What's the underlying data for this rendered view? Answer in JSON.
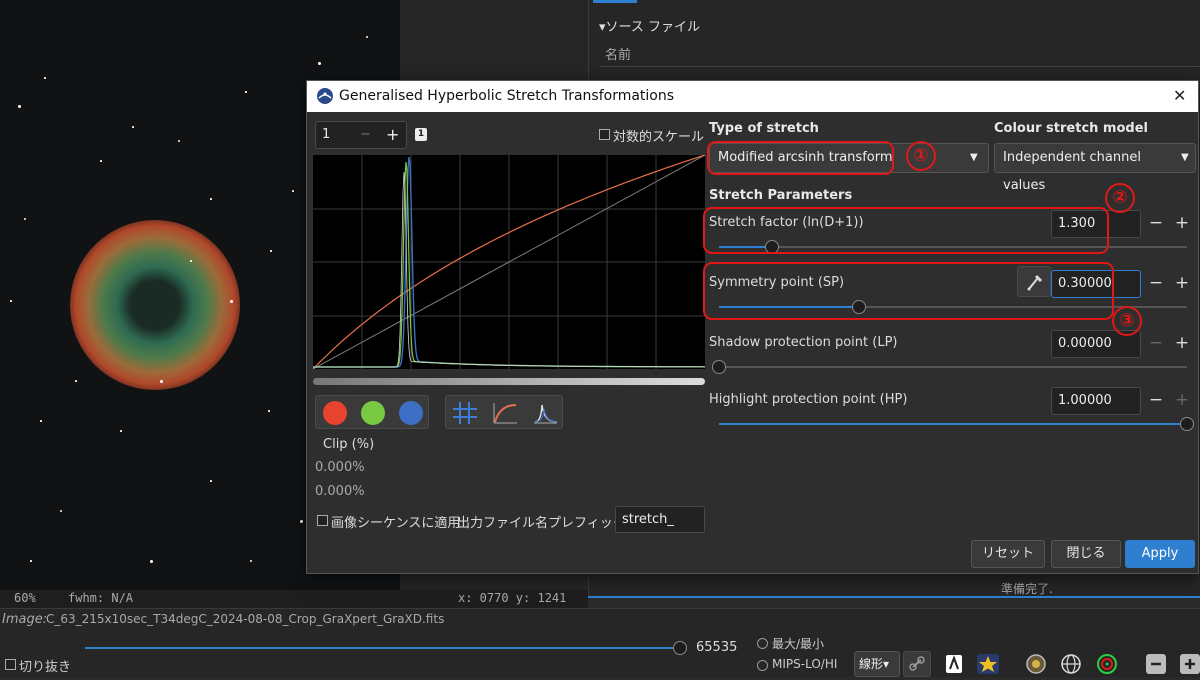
{
  "right_panel": {
    "section_title": "▾ソース ファイル",
    "column_name": "名前",
    "status_ready": "準備完了."
  },
  "status": {
    "zoom": "60%",
    "fwhm": "fwhm: N/A",
    "coords": "x: 0770 y: 1241"
  },
  "bottom": {
    "image_label": "Image:",
    "image_file": "C_63_215x10sec_T34degC_2024-08-08_Crop_GraXpert_GraXD.fits",
    "crop_label": "切り抜き",
    "max_value": "65535",
    "mode_minmax": "最大/最小",
    "mode_mips": "MIPS-LO/HI",
    "scale_mode": "線形▾"
  },
  "dialog": {
    "title": "Generalised Hyperbolic Stretch Transformations",
    "close": "✕",
    "channel_value": "1",
    "minus": "−",
    "plus": "+",
    "badge": "1",
    "log_scale": "対数的スケール",
    "clip_label": "Clip (%)",
    "clip_low": "0.000%",
    "clip_high": "0.000%",
    "apply_sequence": "画像シーケンスに適用",
    "prefix_label": "出力ファイル名プレフィックス:",
    "prefix_value": "stretch_",
    "type_heading": "Type of stretch",
    "type_value": "Modified arcsinh transform",
    "colour_heading": "Colour stretch model",
    "colour_value": "Independent channel values",
    "params_heading": "Stretch Parameters",
    "params": [
      {
        "label": "Stretch factor (ln(D+1))",
        "value": "1.300",
        "level": 0.114
      },
      {
        "label": "Symmetry point (SP)",
        "value": "0.30000",
        "level": 0.3
      },
      {
        "label": "Shadow protection point (LP)",
        "value": "0.00000",
        "level": 0.0
      },
      {
        "label": "Highlight protection point (HP)",
        "value": "1.00000",
        "level": 1.0
      }
    ],
    "btn_reset": "リセット",
    "btn_close": "閉じる",
    "btn_apply": "Apply"
  },
  "annotations": [
    "①",
    "②",
    "③"
  ],
  "colors": {
    "red_channel": "#e8432e",
    "green_channel": "#7ac943",
    "blue_channel": "#3d6fc4",
    "accent": "#2f7fd0",
    "annotation": "#e01818"
  },
  "icons": [
    "eyedropper-icon",
    "grid-icon",
    "curve-icon",
    "histogram-icon"
  ]
}
